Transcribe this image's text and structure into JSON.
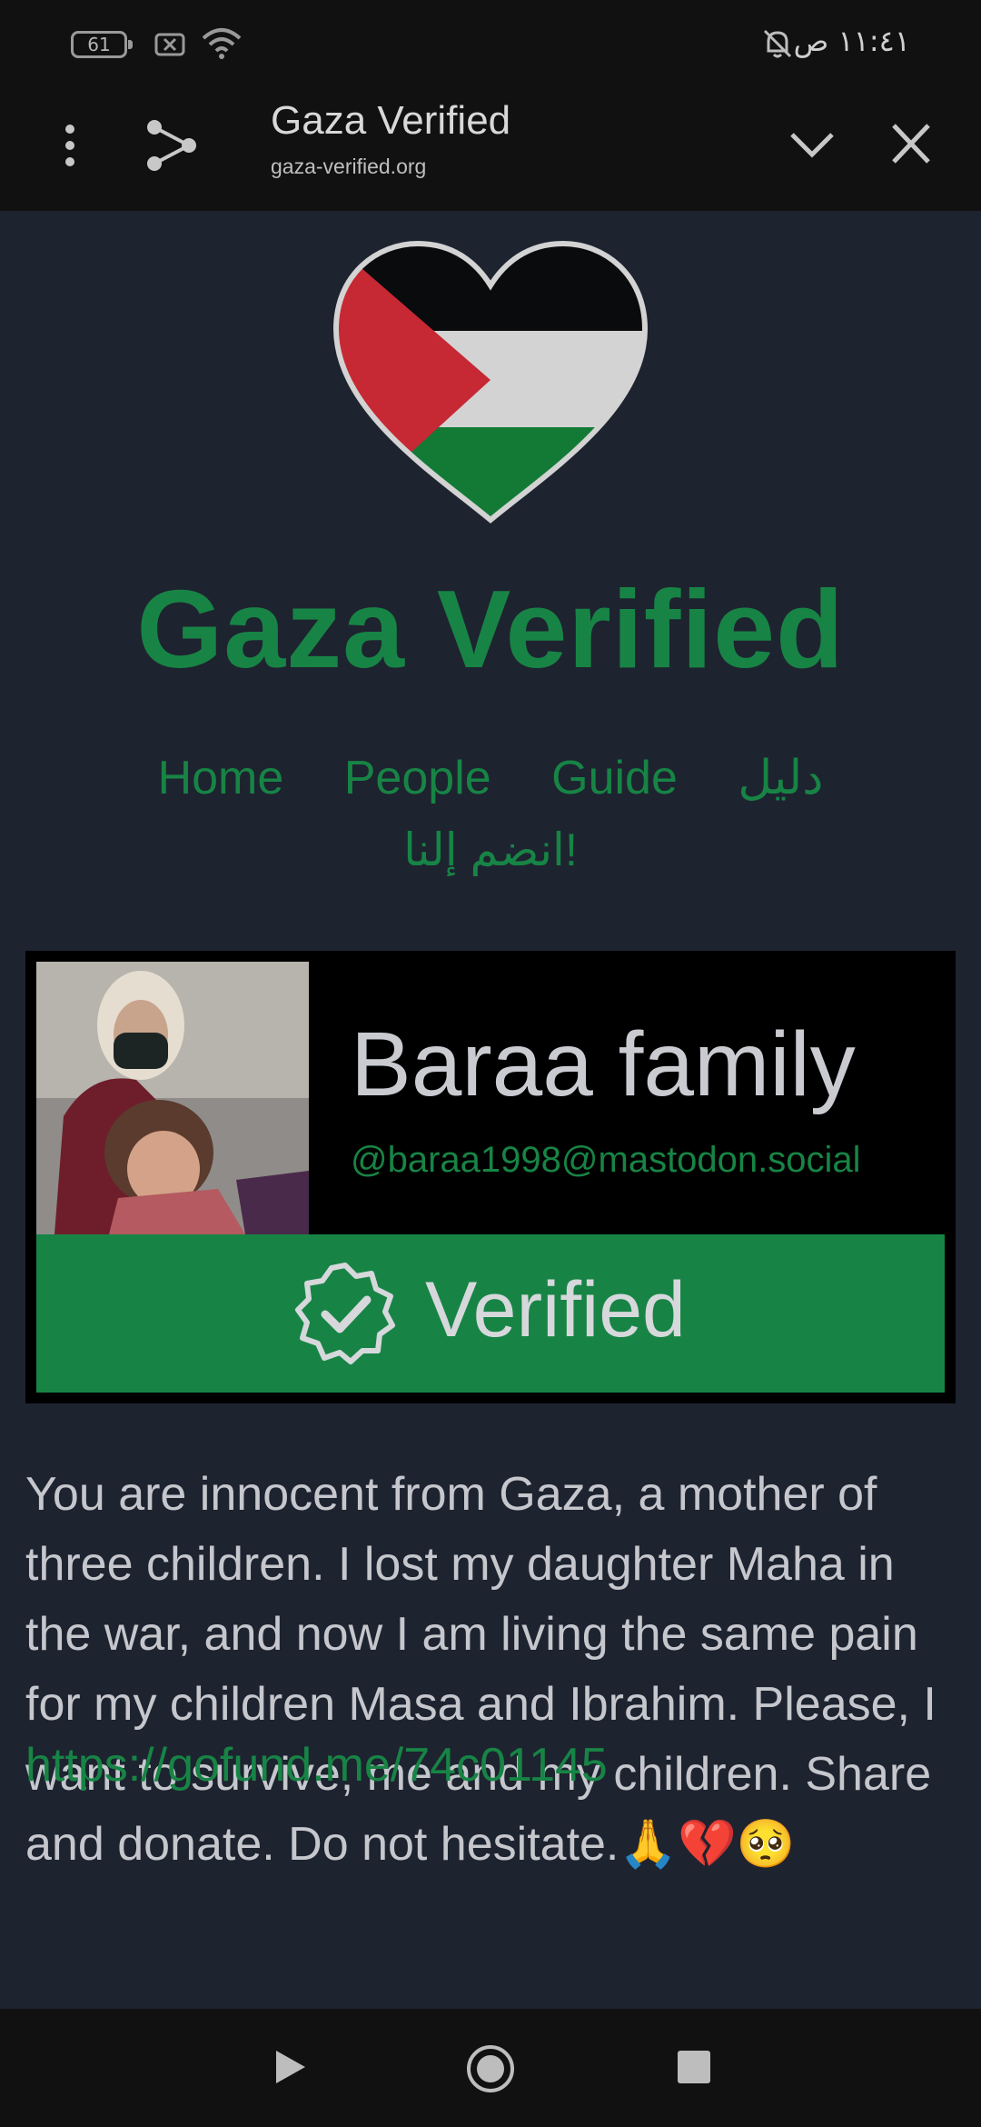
{
  "status_bar": {
    "battery": "61",
    "time": "١١:٤١ ص"
  },
  "toolbar": {
    "title": "Gaza Verified",
    "url": "gaza-verified.org"
  },
  "site": {
    "title": "Gaza Verified",
    "nav": [
      "Home",
      "People",
      "Guide",
      "دليل"
    ],
    "nav_join": "انضم إلنا!"
  },
  "profile": {
    "name": "Baraa family",
    "handle": "@baraa1998@mastodon.social",
    "status": "Verified",
    "bio": "You are innocent from Gaza, a mother of three children. I lost my daughter Maha in the war, and now I am living the same pain for my children Masa and Ibrahim. Please, I want to survive, me and my children. Share and donate. Do not hesitate.🙏💔🥺",
    "link": "https://gofund.me/74c01145"
  },
  "colors": {
    "accent_green": "#178445",
    "background": "#1e2330",
    "bars": "#111111"
  },
  "icons": [
    "kebab-menu-icon",
    "share-icon",
    "chevron-down-icon",
    "close-icon",
    "palestine-heart-logo",
    "verified-badge-icon",
    "back-icon",
    "home-icon",
    "recents-icon"
  ]
}
